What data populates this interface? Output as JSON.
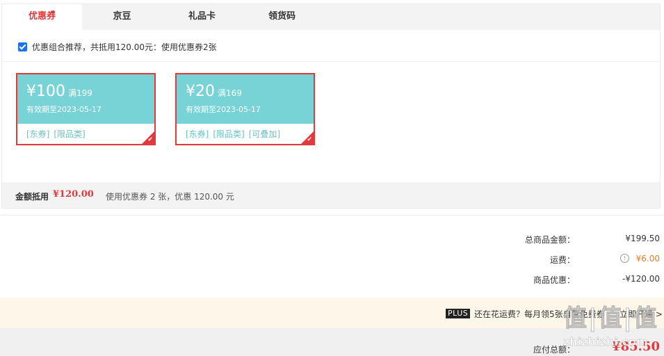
{
  "tabs": [
    {
      "label": "优惠券",
      "active": true
    },
    {
      "label": "京豆",
      "active": false
    },
    {
      "label": "礼品卡",
      "active": false
    },
    {
      "label": "领货码",
      "active": false
    }
  ],
  "combo": {
    "checked": true,
    "text": "优惠组合推荐，共抵用120.00元：使用优惠券2张"
  },
  "coupons": [
    {
      "amount": "¥100",
      "condition": "满199",
      "expiry": "有效期至2023-05-17",
      "tags": [
        "[东券]",
        "[限品类]"
      ],
      "selected": true
    },
    {
      "amount": "¥20",
      "condition": "满169",
      "expiry": "有效期至2023-05-17",
      "tags": [
        "[东券]",
        "[限品类]",
        "[可叠加]"
      ],
      "selected": true
    }
  ],
  "summary": {
    "label": "金额抵用",
    "amount": "¥120.00",
    "description": "使用优惠券 2 张，优惠 120.00 元"
  },
  "totals": {
    "goods_label": "总商品金额：",
    "goods_value": "¥199.50",
    "shipping_label": "运费：",
    "shipping_value": "¥6.00",
    "discount_label": "商品优惠：",
    "discount_value": "-¥120.00"
  },
  "plus": {
    "badge": "PLUS",
    "text": "还在花运费？每月领5张自营免费券",
    "link": "立即开通 >"
  },
  "payable": {
    "label": "应付总额：",
    "value": "¥85.50"
  },
  "watermark": {
    "big": "值|值|值",
    "small": "zhizhizhi.com"
  },
  "colors": {
    "accent_red": "#e4393c",
    "coupon_teal": "#78d3d6",
    "shipping_orange": "#e57c1c"
  }
}
